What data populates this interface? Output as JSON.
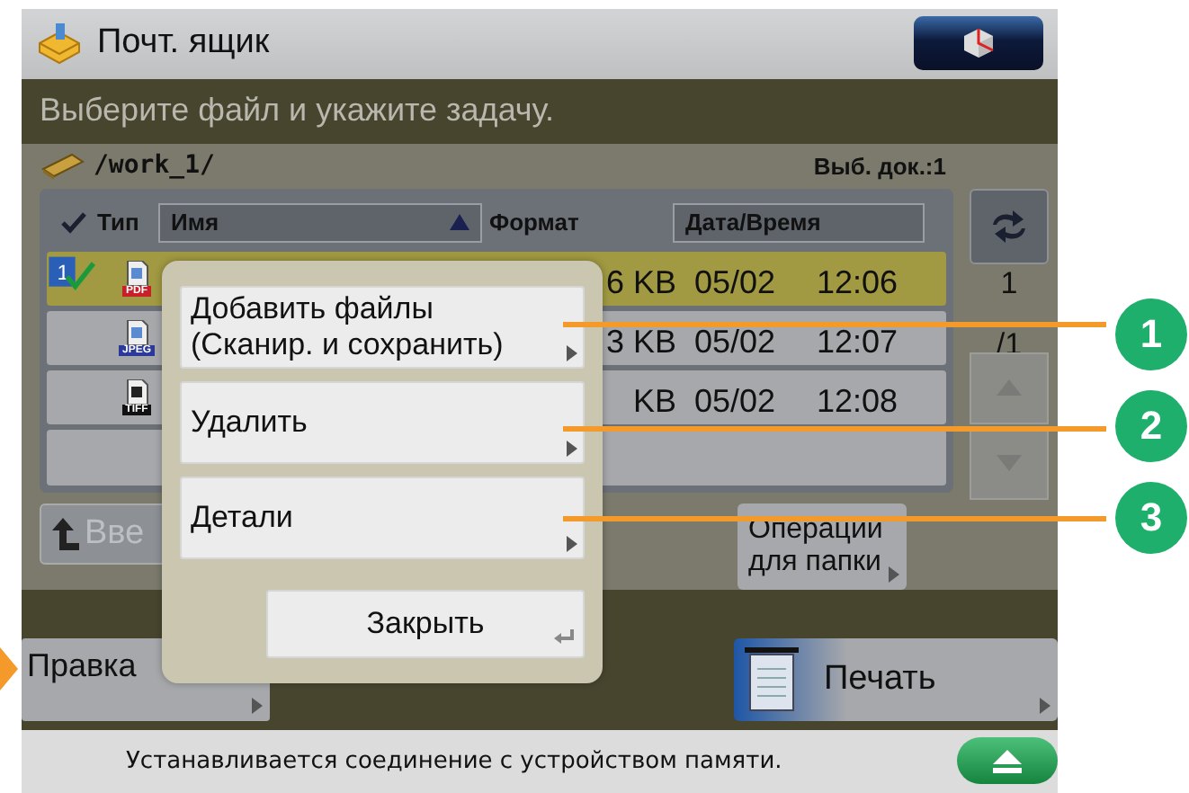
{
  "window": {
    "title": "Почт. ящик"
  },
  "instruction": "Выберите файл и укажите задачу.",
  "path": "/work_1/",
  "selected_count": "Выб. док.:1",
  "table": {
    "columns": [
      {
        "label": "Тип",
        "kind": "check"
      },
      {
        "label": "Имя",
        "kind": "sort"
      },
      {
        "label": "Формат",
        "kind": "plain"
      },
      {
        "label": "Дата/Время",
        "kind": "button"
      }
    ],
    "rows": [
      {
        "selected": true,
        "order": "1",
        "format": "PDF",
        "kind": "pdf",
        "size": "6 KB",
        "date": "05/02",
        "time": "12:06"
      },
      {
        "selected": false,
        "format": "JPEG",
        "kind": "jpeg",
        "size": "3 KB",
        "date": "05/02",
        "time": "12:07"
      },
      {
        "selected": false,
        "format": "TIFF",
        "kind": "tiff",
        "size": "KB",
        "date": "05/02",
        "time": "12:08"
      }
    ]
  },
  "pager": {
    "page": "1",
    "total": "/1"
  },
  "back_button": "Вве",
  "folder_button": "Операции для папки",
  "edit_button": "Правка",
  "print_button": "Печать",
  "status": "Устанавливается соединение с устройством памяти.",
  "popup": {
    "items": [
      {
        "label": "Добавить файлы (Сканир. и сохранить)"
      },
      {
        "label": "Удалить"
      },
      {
        "label": "Детали"
      }
    ],
    "close": "Закрыть"
  },
  "callouts": [
    "1",
    "2",
    "3"
  ]
}
